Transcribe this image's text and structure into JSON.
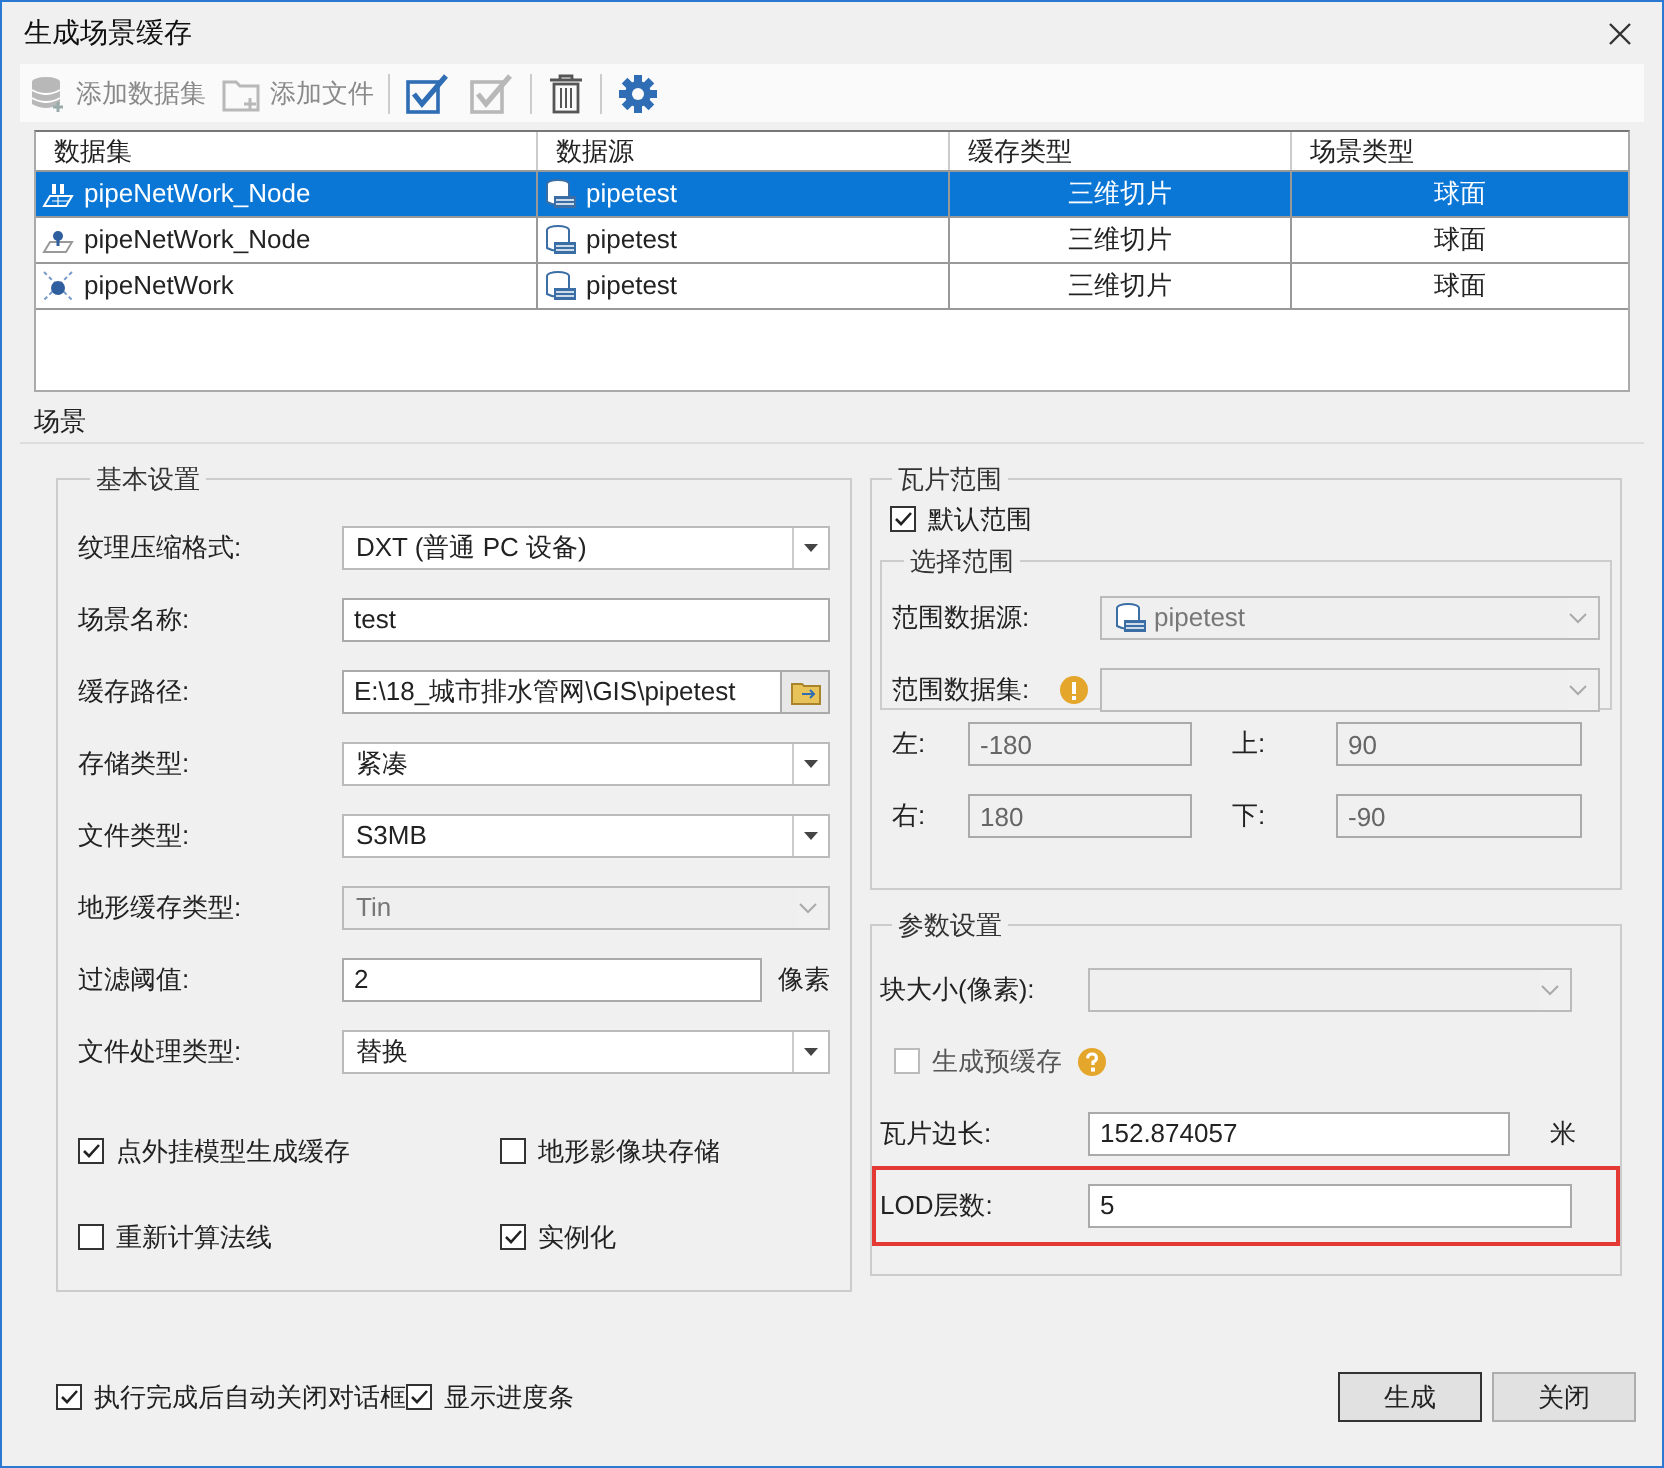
{
  "window": {
    "title": "生成场景缓存"
  },
  "toolbar": [
    {
      "kind": "labeled",
      "label": "添加数据集",
      "disabled": true
    },
    {
      "kind": "labeled",
      "label": "添加文件",
      "disabled": true
    },
    {
      "kind": "icon",
      "disabled": false
    },
    {
      "kind": "icon",
      "disabled": true
    },
    {
      "kind": "icon",
      "disabled": false
    },
    {
      "kind": "icon",
      "disabled": false
    }
  ],
  "table": {
    "columns": [
      "数据集",
      "数据源",
      "缓存类型",
      "场景类型"
    ],
    "rows": [
      {
        "kind": "point3d",
        "selected": true,
        "cells": [
          "pipeNetWork_Node",
          "pipetest",
          "三维切片",
          "球面"
        ]
      },
      {
        "kind": "point",
        "selected": false,
        "cells": [
          "pipeNetWork_Node",
          "pipetest",
          "三维切片",
          "球面"
        ]
      },
      {
        "kind": "network",
        "selected": false,
        "cells": [
          "pipeNetWork",
          "pipetest",
          "三维切片",
          "球面"
        ]
      }
    ]
  },
  "tabs": [
    {
      "label": "场景",
      "selected": true
    }
  ],
  "basic_settings": {
    "title": "基本设置",
    "fields": [
      {
        "kind": "select",
        "label": "纹理压缩格式:",
        "value": "DXT (普通 PC 设备)",
        "disabled": false
      },
      {
        "kind": "text",
        "label": "场景名称:",
        "value": "test"
      },
      {
        "kind": "path",
        "label": "缓存路径:",
        "value": "E:\\18_城市排水管网\\GIS\\pipetest"
      },
      {
        "kind": "select",
        "label": "存储类型:",
        "value": "紧凑",
        "disabled": false
      },
      {
        "kind": "select",
        "label": "文件类型:",
        "value": "S3MB",
        "disabled": false
      },
      {
        "kind": "select",
        "label": "地形缓存类型:",
        "value": "Tin",
        "disabled": true
      },
      {
        "kind": "text",
        "label": "过滤阈值:",
        "value": "2",
        "unit": "像素"
      },
      {
        "kind": "select",
        "label": "文件处理类型:",
        "value": "替换",
        "disabled": false
      }
    ],
    "checkboxes": [
      {
        "label": "点外挂模型生成缓存",
        "checked": true
      },
      {
        "label": "地形影像块存储",
        "checked": false
      },
      {
        "label": "重新计算法线",
        "checked": false
      },
      {
        "label": "实例化",
        "checked": true
      }
    ]
  },
  "tile_range": {
    "title": "瓦片范围",
    "default_range": {
      "label": "默认范围",
      "checked": true
    },
    "select_range": {
      "title": "选择范围",
      "fields": [
        {
          "label": "范围数据源:",
          "value": "pipetest",
          "warning": false
        },
        {
          "label": "范围数据集:",
          "warning": true
        }
      ]
    },
    "bounds": [
      {
        "label": "左:",
        "value": "-180"
      },
      {
        "label": "上:",
        "value": "90"
      },
      {
        "label": "右:",
        "value": "180"
      },
      {
        "label": "下:",
        "value": "-90"
      }
    ]
  },
  "parameters": {
    "title": "参数设置",
    "fields": [
      {
        "kind": "select",
        "label": "块大小(像素):",
        "disabled": true
      },
      {
        "kind": "checkbox",
        "label": "生成预缓存",
        "checked": false,
        "disabled": true
      },
      {
        "kind": "text",
        "label": "瓦片边长:",
        "value": "152.874057",
        "unit": "米",
        "highlighted": false
      },
      {
        "kind": "text",
        "label": "LOD层数:",
        "value": "5",
        "highlighted": true
      }
    ]
  },
  "footer": {
    "checkboxes": [
      {
        "label": "执行完成后自动关闭对话框",
        "checked": true
      },
      {
        "label": "显示进度条",
        "checked": true
      }
    ],
    "buttons": [
      {
        "label": "生成",
        "default": true
      },
      {
        "label": "关闭",
        "default": false
      }
    ]
  }
}
